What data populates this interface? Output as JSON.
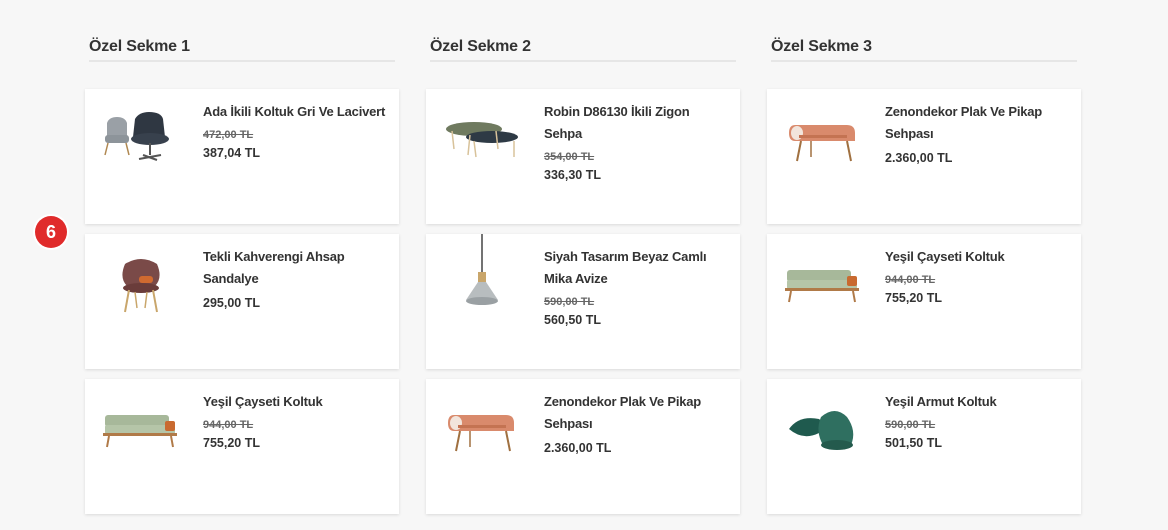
{
  "step_badge": "6",
  "columns": [
    {
      "title": "Özel Sekme 1",
      "products": [
        {
          "name": "Ada İkili Koltuk Gri Ve Lacivert",
          "old_price": "472,00 TL",
          "price": "387,04 TL",
          "image": "two-armchairs-icon"
        },
        {
          "name": "Tekli Kahverengi Ahsap Sandalye",
          "old_price": "",
          "price": "295,00 TL",
          "image": "brown-chair-icon"
        },
        {
          "name": "Yeşil Çayseti Koltuk",
          "old_price": "944,00 TL",
          "price": "755,20 TL",
          "image": "green-sofa-icon"
        }
      ]
    },
    {
      "title": "Özel Sekme 2",
      "products": [
        {
          "name": "Robin D86130 İkili Zigon Sehpa",
          "old_price": "354,00 TL",
          "price": "336,30 TL",
          "image": "nesting-tables-icon"
        },
        {
          "name": "Siyah Tasarım Beyaz Camlı Mika Avize",
          "old_price": "590,00 TL",
          "price": "560,50 TL",
          "image": "pendant-lamp-icon"
        },
        {
          "name": "Zenondekor Plak Ve Pikap Sehpası",
          "old_price": "",
          "price": "2.360,00 TL",
          "image": "record-table-icon"
        }
      ]
    },
    {
      "title": "Özel Sekme 3",
      "products": [
        {
          "name": "Zenondekor Plak Ve Pikap Sehpası",
          "old_price": "",
          "price": "2.360,00 TL",
          "image": "record-table-icon"
        },
        {
          "name": "Yeşil Çayseti Koltuk",
          "old_price": "944,00 TL",
          "price": "755,20 TL",
          "image": "green-sofa-icon"
        },
        {
          "name": "Yeşil Armut Koltuk",
          "old_price": "590,00 TL",
          "price": "501,50 TL",
          "image": "green-pouf-icon"
        }
      ]
    }
  ]
}
